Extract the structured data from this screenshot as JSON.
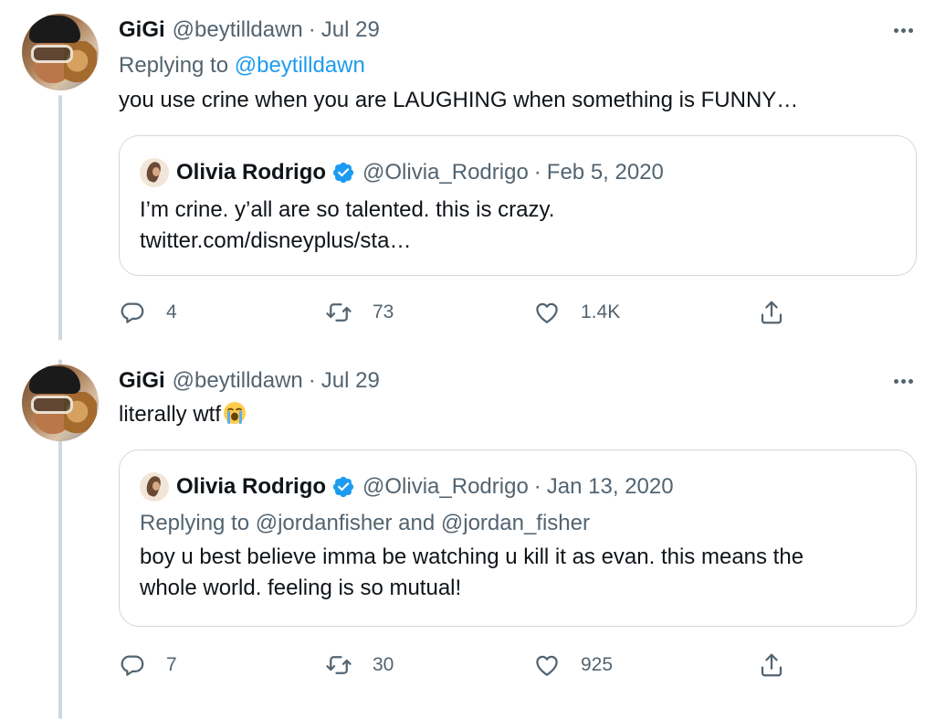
{
  "tweets": [
    {
      "author_name": "GiGi",
      "author_handle": "@beytilldawn",
      "separator": "·",
      "date": "Jul 29",
      "replying_prefix": "Replying to ",
      "replying_to": "@beytilldawn",
      "text": "you use crine when you are LAUGHING when something is FUNNY…",
      "quote": {
        "author_name": "Olivia Rodrigo",
        "author_handle": "@Olivia_Rodrigo",
        "separator": "·",
        "date": "Feb 5, 2020",
        "lines": [
          "I’m crine. y’all are so talented. this is crazy.",
          "twitter.com/disneyplus/sta…"
        ]
      },
      "counts": {
        "replies": "4",
        "retweets": "73",
        "likes": "1.4K"
      }
    },
    {
      "author_name": "GiGi",
      "author_handle": "@beytilldawn",
      "separator": "·",
      "date": "Jul 29",
      "text": "literally wtf",
      "emoji": "loudly-crying-face",
      "quote": {
        "author_name": "Olivia Rodrigo",
        "author_handle": "@Olivia_Rodrigo",
        "separator": "·",
        "date": "Jan 13, 2020",
        "replying": "Replying to @jordanfisher and @jordan_fisher",
        "lines": [
          "boy u best believe imma be watching u kill it as evan. this means the",
          "whole world. feeling is so mutual!"
        ]
      },
      "counts": {
        "replies": "7",
        "retweets": "30",
        "likes": "925"
      }
    }
  ],
  "icons": {
    "reply": "reply-icon",
    "retweet": "retweet-icon",
    "like": "heart-icon",
    "share": "share-icon",
    "more": "more-icon",
    "verified": "verified-badge-icon"
  },
  "colors": {
    "text": "#0f1419",
    "secondary": "#536471",
    "link": "#1d9bf0",
    "verified": "#1d9bf0",
    "border": "#cfd9de"
  }
}
